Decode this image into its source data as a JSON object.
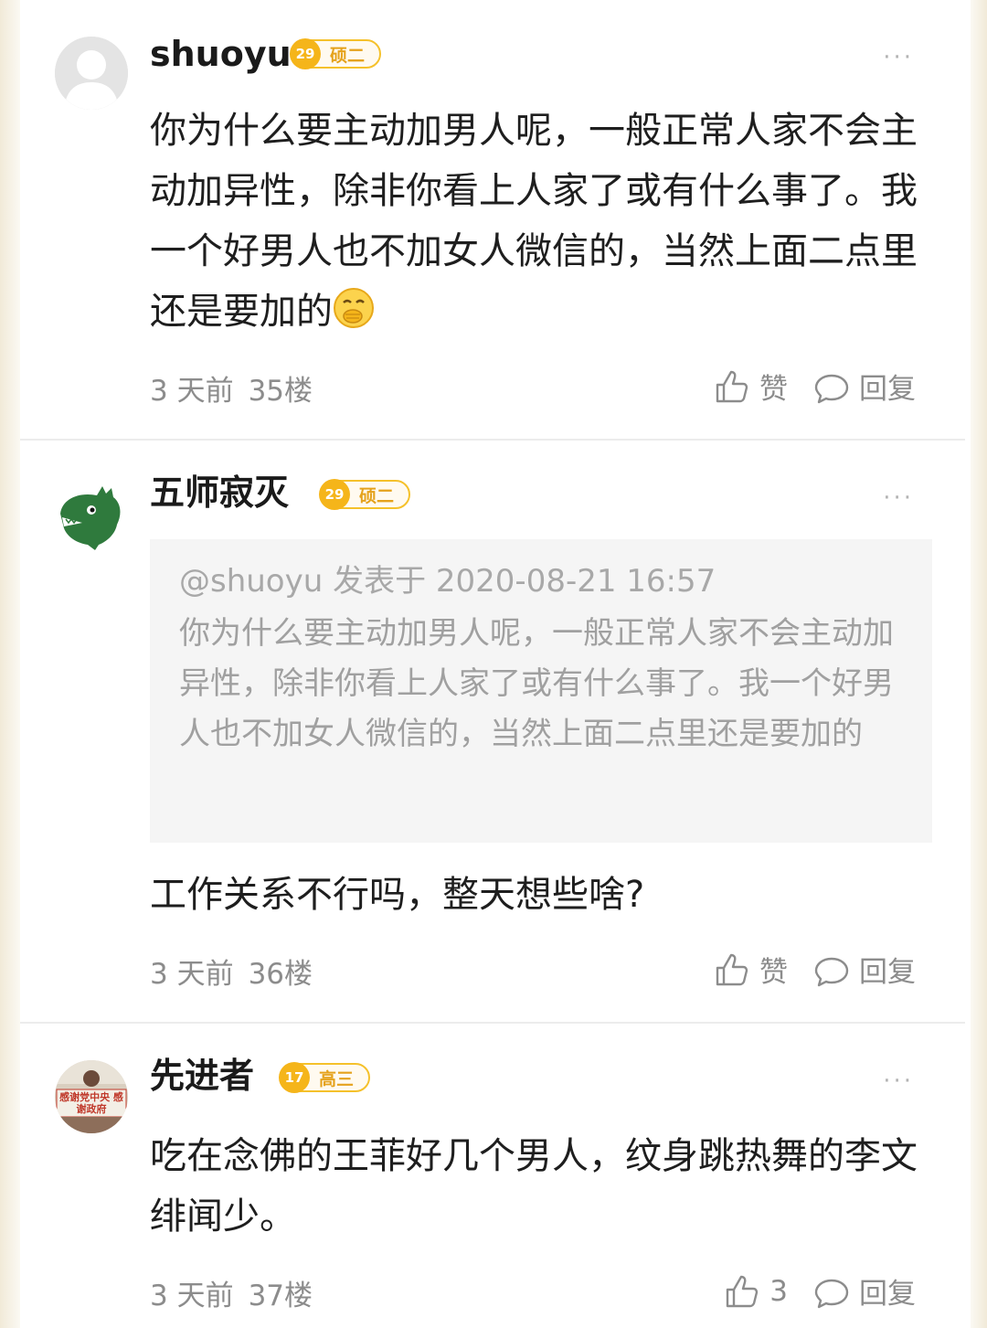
{
  "comments": [
    {
      "username": "shuoyu",
      "badge": {
        "level_icon": "29",
        "grade": "硕二"
      },
      "more": "···",
      "text": "你为什么要主动加男人呢，一般正常人家不会主动加异性，除非你看上人家了或有什么事了。我一个好男人也不加女人微信的，当然上面二点里还是要加的",
      "emoji": "face-with-hand-over-mouth",
      "time": "3 天前",
      "floor": "35楼",
      "like_label": "赞",
      "reply_label": "回复"
    },
    {
      "username": "五师寂灭",
      "badge": {
        "level_icon": "29",
        "grade": "硕二"
      },
      "more": "···",
      "quote": {
        "header": "@shuoyu 发表于 2020-08-21 16:57",
        "text": "你为什么要主动加男人呢，一般正常人家不会主动加异性，除非你看上人家了或有什么事了。我一个好男人也不加女人微信的，当然上面二点里还是要加的"
      },
      "text": "工作关系不行吗，整天想些啥?",
      "time": "3 天前",
      "floor": "36楼",
      "like_label": "赞",
      "reply_label": "回复"
    },
    {
      "username": "先进者",
      "badge": {
        "level_icon": "17",
        "grade": "高三"
      },
      "more": "···",
      "text": "吃在念佛的王菲好几个男人，纹身跳热舞的李文绯闻少。",
      "time": "3 天前",
      "floor": "37楼",
      "like_label": "3",
      "reply_label": "回复"
    }
  ],
  "avatar_sign_text": "感谢党中央 感谢政府",
  "colors": {
    "badge": "#f5c12b",
    "badge_text": "#e5a21c",
    "meta": "#8c8c8c",
    "quote_bg": "#f5f5f5"
  }
}
